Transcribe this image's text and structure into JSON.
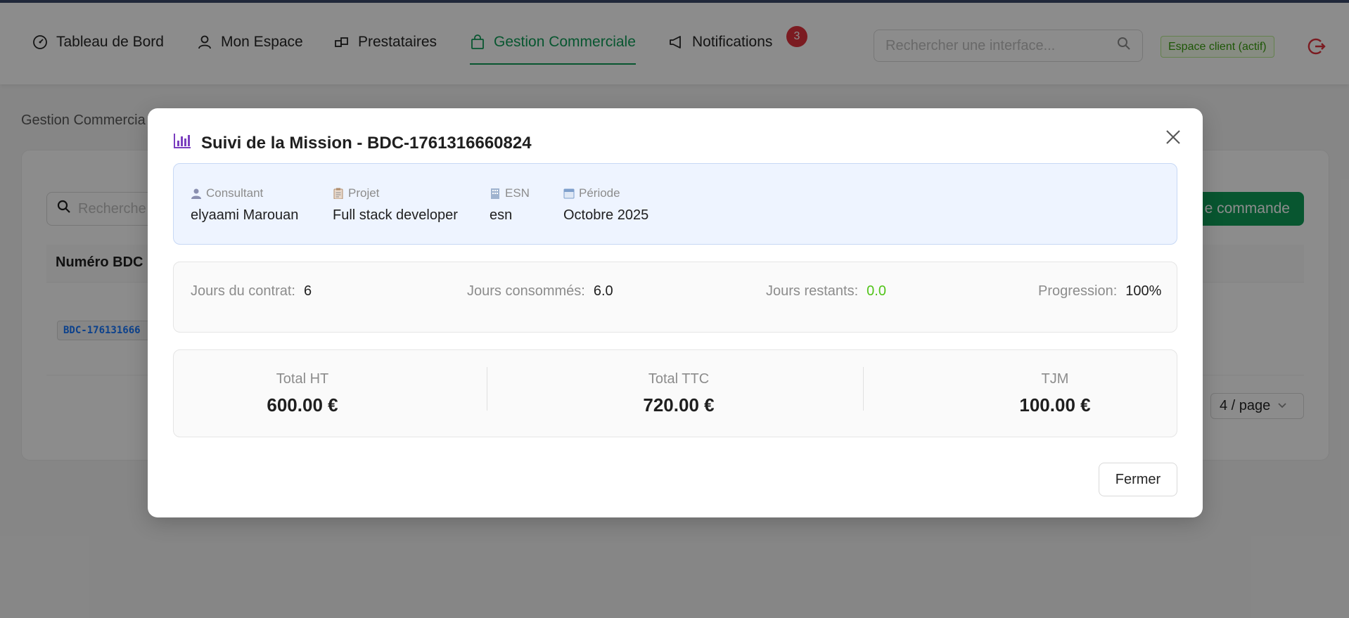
{
  "nav": {
    "items": [
      {
        "label": "Tableau de Bord",
        "icon": "dashboard-icon"
      },
      {
        "label": "Mon Espace",
        "icon": "user-icon"
      },
      {
        "label": "Prestataires",
        "icon": "building-icon"
      },
      {
        "label": "Gestion Commerciale",
        "icon": "shopping-bag-icon",
        "active": true
      },
      {
        "label": "Notifications",
        "icon": "megaphone-icon"
      }
    ],
    "notification_count": "3",
    "search_placeholder": "Rechercher une interface...",
    "client_tag": "Espace client (actif)"
  },
  "page": {
    "title": "Gestion Commercia",
    "search_placeholder": "Recherche",
    "new_order_label": "e commande",
    "table_header": "Numéro BDC",
    "row_code": "BDC-176131666",
    "page_size": "4 / page"
  },
  "modal": {
    "title": "Suivi de la Mission - BDC-1761316660824",
    "info": {
      "consultant_label": "Consultant",
      "consultant_value": "elyaami Marouan",
      "projet_label": "Projet",
      "projet_value": "Full stack developer",
      "esn_label": "ESN",
      "esn_value": "esn",
      "periode_label": "Période",
      "periode_value": "Octobre 2025"
    },
    "stats": {
      "contract_days_label": "Jours du contrat:",
      "contract_days": "6",
      "consumed_days_label": "Jours consommés:",
      "consumed_days": "6.0",
      "remaining_days_label": "Jours restants:",
      "remaining_days": "0.0",
      "progress_label": "Progression:",
      "progress": "100%"
    },
    "totals": {
      "ht_label": "Total HT",
      "ht_value": "600.00 €",
      "ttc_label": "Total TTC",
      "ttc_value": "720.00 €",
      "tjm_label": "TJM",
      "tjm_value": "100.00 €"
    },
    "close_label": "Fermer"
  },
  "colors": {
    "accent_green": "#0f9d58",
    "remaining_green": "#52c41a",
    "badge_red": "#e0323c",
    "title_icon_purple": "#7b3fbf"
  }
}
